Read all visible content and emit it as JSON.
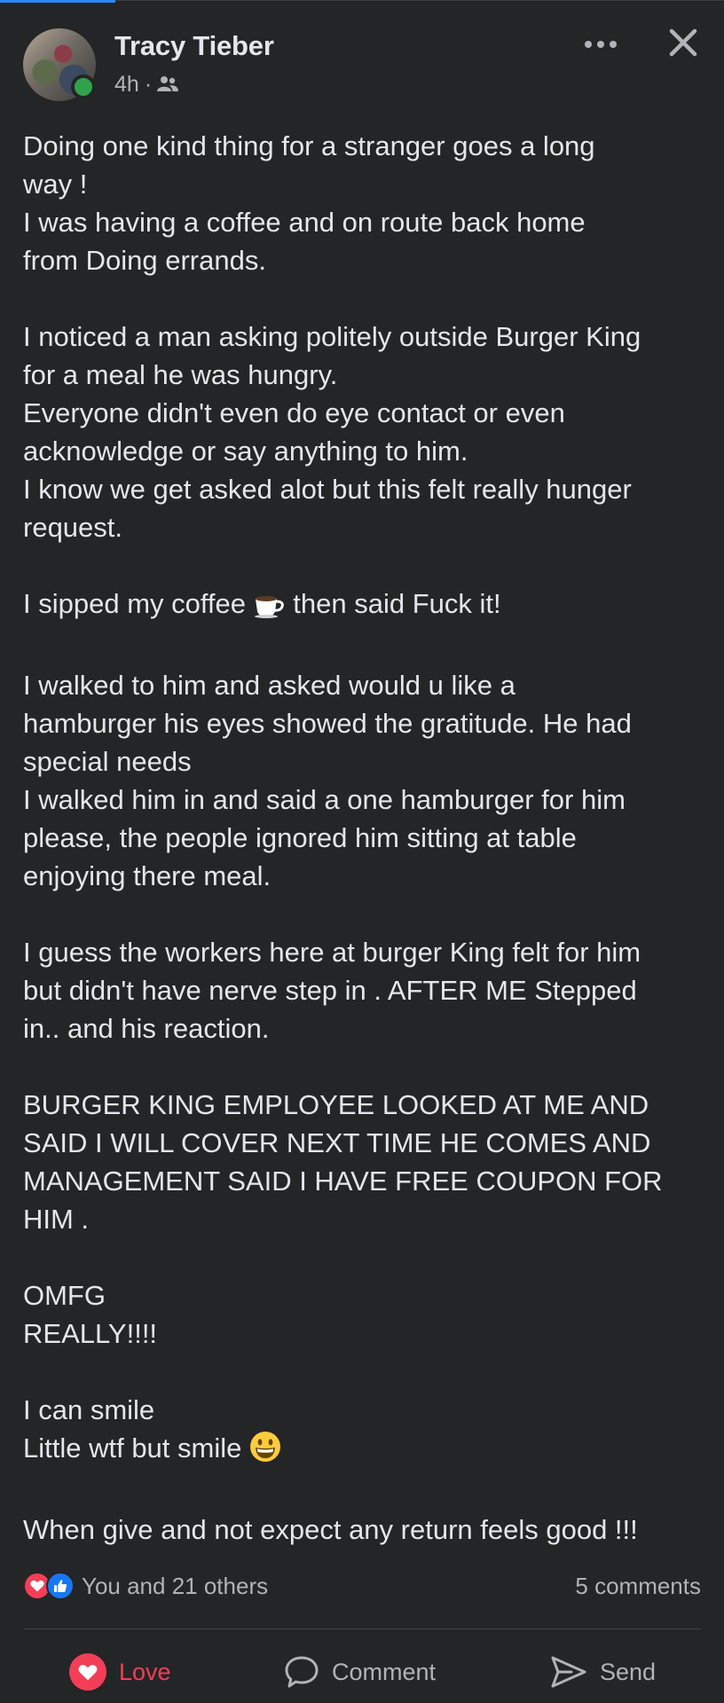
{
  "post": {
    "author": "Tracy Tieber",
    "time": "4h",
    "separator": "·",
    "audience_icon": "friends-icon",
    "body": [
      [
        "Doing one kind thing for a stranger goes a long",
        "way !",
        "I was having a coffee and on route back home",
        "from Doing errands."
      ],
      [
        "I noticed a man asking politely outside Burger King",
        "for a meal he was hungry.",
        "Everyone didn't even do eye contact or even",
        "acknowledge or say anything to him.",
        "I know we get asked alot but this felt really hunger",
        "request."
      ],
      [
        "I sipped my coffee",
        "then said Fuck it!"
      ],
      [
        "I walked to him and asked would u like a",
        "hamburger his eyes showed the gratitude.  He had",
        "special needs",
        "I walked him in and said a one hamburger for him",
        "please,  the people ignored him sitting at table",
        "enjoying there meal."
      ],
      [
        "I guess the workers here at burger King felt for him",
        "but didn't have nerve step in . AFTER ME Stepped",
        "in.. and his reaction."
      ],
      [
        "BURGER KING EMPLOYEE  LOOKED AT ME AND",
        "SAID I WILL COVER NEXT TIME HE COMES AND",
        "MANAGEMENT SAID I HAVE FREE COUPON FOR",
        "HIM ."
      ],
      [
        "OMFG",
        "REALLY!!!!"
      ],
      [
        "I can smile",
        "Little wtf but smile"
      ],
      [
        "When give and not expect any return feels good !!!"
      ]
    ],
    "emojis": {
      "coffee": "hot-beverage-icon",
      "smile": "grinning-face-icon"
    }
  },
  "reactions": {
    "icons": [
      "love-reaction-icon",
      "like-reaction-icon"
    ],
    "summary": "You and 21 others",
    "comments": "5 comments"
  },
  "actions": {
    "love_label": "Love",
    "comment_label": "Comment",
    "send_label": "Send"
  },
  "colors": {
    "background": "#242526",
    "text": "#e4e6eb",
    "secondary_text": "#b0b3b8",
    "love": "#f33e58",
    "like": "#1877f2",
    "online": "#31a24c"
  }
}
